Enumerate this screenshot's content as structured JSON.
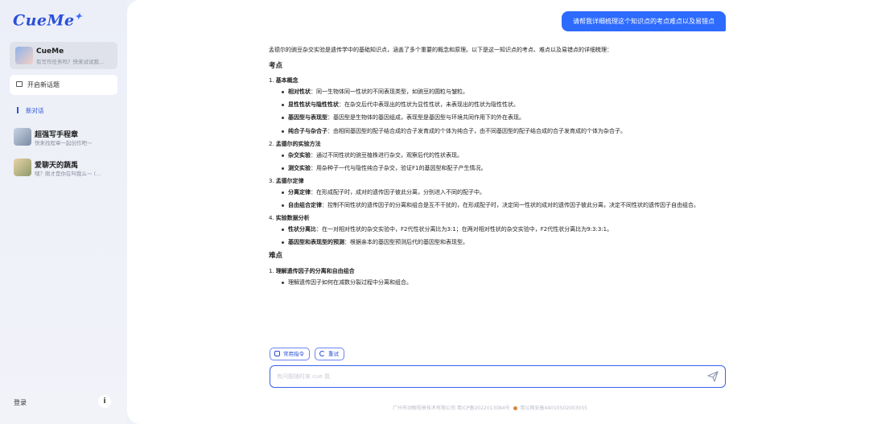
{
  "sidebar": {
    "logo": "CueMe",
    "active_bot": {
      "title": "CueMe",
      "subtitle": "有写作任务吗？快来试试我..."
    },
    "new_topic_label": "开启新话题",
    "section_label": "新对话",
    "chats": [
      {
        "title": "超强写手程章",
        "subtitle": "快来找程章一起创作吧～"
      },
      {
        "title": "爱聊天的蔬禹",
        "subtitle": "嘿？刚才是你在叫我么～ (..."
      }
    ],
    "login_label": "登录",
    "info_label": "i"
  },
  "conversation": {
    "user_message": "请帮我详细梳理这个知识点的考点难点以及易错点",
    "intro": "孟德尔的豌豆杂交实验是遗传学中的基础知识点，涵盖了多个重要的概念和原理。以下是这一知识点的考点、难点以及易错点的详细梳理：",
    "sections": [
      {
        "heading": "考点",
        "items": [
          {
            "num": "1.",
            "title": "基本概念",
            "bullets": [
              {
                "term": "相对性状",
                "text": "：同一生物体同一性状的不同表现类型，如豌豆的圆粒与皱粒。"
              },
              {
                "term": "显性性状与隐性性状",
                "text": "：在杂交后代中表现出的性状为显性性状，未表现出的性状为隐性性状。"
              },
              {
                "term": "基因型与表现型",
                "text": "：基因型是生物体的基因组成，表现型是基因型与环境共同作用下的外在表现。"
              },
              {
                "term": "纯合子与杂合子",
                "text": "：由相同基因型的配子结合成的合子发育成的个体为纯合子，由不同基因型的配子结合成的合子发育成的个体为杂合子。"
              }
            ]
          },
          {
            "num": "2.",
            "title": "孟德尔的实验方法",
            "bullets": [
              {
                "term": "杂交实验",
                "text": "：通过不同性状的豌豆植株进行杂交，观察后代的性状表现。"
              },
              {
                "term": "测交实验",
                "text": "：用杂种子一代与隐性纯合子杂交，验证F1的基因型和配子产生情况。"
              }
            ]
          },
          {
            "num": "3.",
            "title": "孟德尔定律",
            "bullets": [
              {
                "term": "分离定律",
                "text": "：在形成配子时，成对的遗传因子彼此分离，分别进入不同的配子中。"
              },
              {
                "term": "自由组合定律",
                "text": "：控制不同性状的遗传因子的分离和组合是互不干扰的，在形成配子时，决定同一性状的成对的遗传因子彼此分离，决定不同性状的遗传因子自由组合。"
              }
            ]
          },
          {
            "num": "4.",
            "title": "实验数据分析",
            "bullets": [
              {
                "term": "性状分离比",
                "text": "：在一对相对性状的杂交实验中，F2代性状分离比为3:1；在两对相对性状的杂交实验中，F2代性状分离比为9:3:3:1。"
              },
              {
                "term": "基因型和表现型的预测",
                "text": "：根据亲本的基因型预测后代的基因型和表现型。"
              }
            ]
          }
        ]
      },
      {
        "heading": "难点",
        "items": [
          {
            "num": "1.",
            "title": "理解遗传因子的分离和自由组合",
            "bullets": [
              {
                "term": "",
                "text": "理解遗传因子如何在减数分裂过程中分离和组合。"
              }
            ]
          }
        ]
      }
    ]
  },
  "toolbar": {
    "common_commands_label": "常用指令",
    "retry_label": "重试"
  },
  "input": {
    "placeholder": "有问题随时来 cue 我",
    "value": ""
  },
  "footer": {
    "icp": "广州市动眼视景技术有限公司 粤ICP备2022013084号",
    "police": "粤公网安备44010502003055"
  },
  "colors": {
    "accent": "#2d6bff",
    "sidebar_bg": "#eceff8"
  },
  "icons": {
    "new_topic": "chat-plus-icon",
    "commands": "list-icon",
    "retry": "refresh-icon",
    "send": "send-icon",
    "info": "info-icon"
  }
}
